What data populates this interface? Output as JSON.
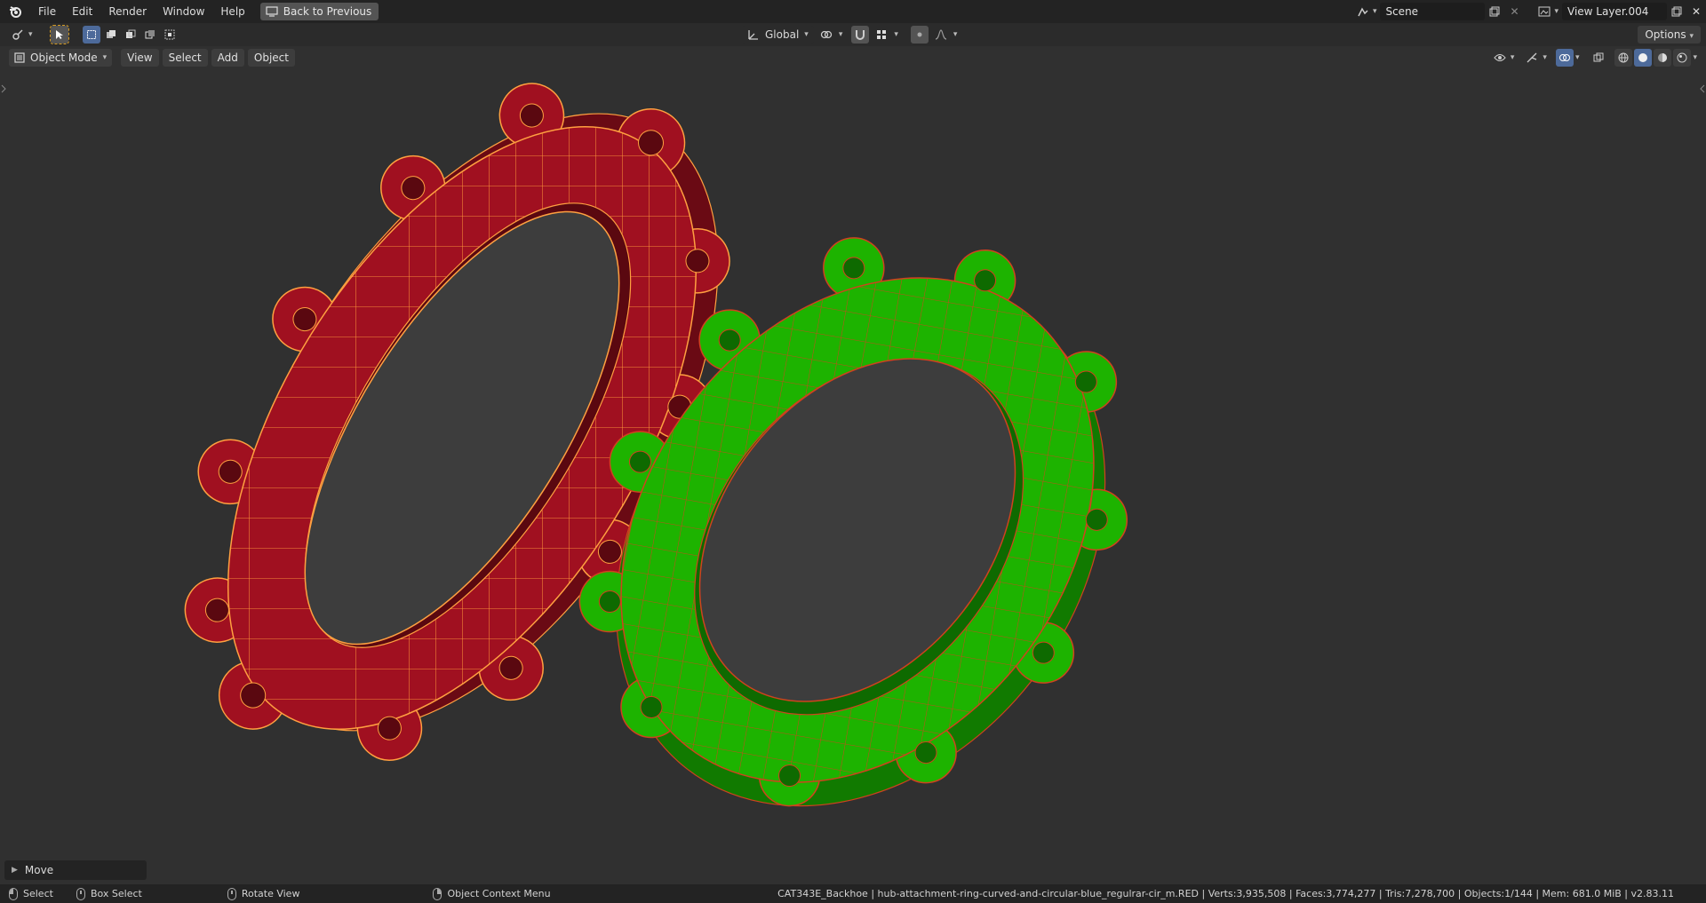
{
  "topbar": {
    "menus": [
      "File",
      "Edit",
      "Render",
      "Window",
      "Help"
    ],
    "back_button": "Back to Previous",
    "scene_name": "Scene",
    "view_layer": "View Layer.004"
  },
  "toolheader": {
    "orientation": "Global",
    "options_label": "Options"
  },
  "viewheader": {
    "mode": "Object Mode",
    "menus": [
      "View",
      "Select",
      "Add",
      "Object"
    ]
  },
  "operator_panel": {
    "label": "Move"
  },
  "statusbar": {
    "select": "Select",
    "box_select": "Box Select",
    "rotate_view": "Rotate View",
    "context_menu": "Object Context Menu",
    "info": "CAT343E_Backhoe | hub-attachment-ring-curved-and-circular-blue_regulrar-cir_m.RED | Verts:3,935,508 | Faces:3,774,277 | Tris:7,278,700 | Objects:1/144 | Mem: 681.0 MiB | v2.83.11"
  },
  "colors": {
    "viewport_bg": "#3d3d3d",
    "red_object": "#a01020",
    "red_wire": "#ffa040",
    "green_object": "#1db300",
    "green_wire": "#d04020",
    "accent_blue": "#4d6a9a"
  }
}
